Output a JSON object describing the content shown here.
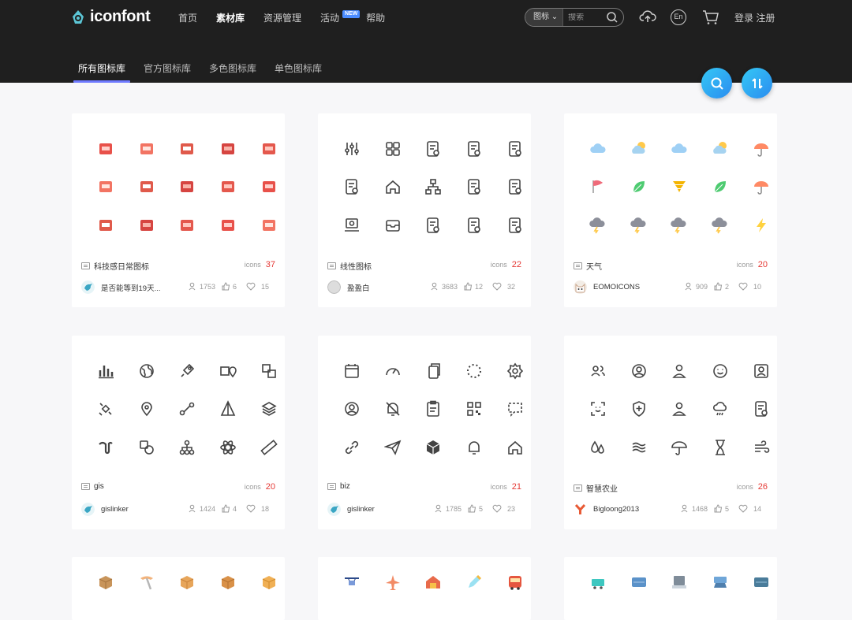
{
  "header": {
    "logo": "iconfont",
    "nav": [
      {
        "label": "首页",
        "active": false
      },
      {
        "label": "素材库",
        "active": true
      },
      {
        "label": "资源管理",
        "active": false
      },
      {
        "label": "活动",
        "active": false,
        "badge": "NEW"
      },
      {
        "label": "帮助",
        "active": false
      }
    ],
    "search": {
      "type": "图标",
      "placeholder": "搜索"
    },
    "lang": "En",
    "login": "登录",
    "register": "注册"
  },
  "tabs": [
    {
      "label": "所有图标库",
      "active": true
    },
    {
      "label": "官方图标库",
      "active": false
    },
    {
      "label": "多色图标库",
      "active": false
    },
    {
      "label": "单色图标库",
      "active": false
    }
  ],
  "count_label": "icons",
  "cards": [
    {
      "title": "科技感日常图标",
      "count": "37",
      "user": "是否能等到19天...",
      "views": "1753",
      "likes": "6",
      "favs": "15",
      "style": "red",
      "avatar": "bird"
    },
    {
      "title": "线性图标",
      "count": "22",
      "user": "盈盈白",
      "views": "3683",
      "likes": "12",
      "favs": "32",
      "style": "line",
      "avatar": "gray"
    },
    {
      "title": "天气",
      "count": "20",
      "user": "EOMOICONS",
      "views": "909",
      "likes": "2",
      "favs": "10",
      "style": "weather",
      "avatar": "cat"
    },
    {
      "title": "gis",
      "count": "20",
      "user": "gislinker",
      "views": "1424",
      "likes": "4",
      "favs": "18",
      "style": "thin",
      "avatar": "bird"
    },
    {
      "title": "biz",
      "count": "21",
      "user": "gislinker",
      "views": "1785",
      "likes": "5",
      "favs": "23",
      "style": "thin",
      "avatar": "bird"
    },
    {
      "title": "智慧农业",
      "count": "26",
      "user": "Bigloong2013",
      "views": "1468",
      "likes": "5",
      "favs": "14",
      "style": "thin",
      "avatar": "y"
    }
  ],
  "colors": {
    "header_bg": "#1f1f1f",
    "tab_indicator": "#6f7aff",
    "count_red": "#e53935",
    "fab": "#2a9ef3"
  }
}
